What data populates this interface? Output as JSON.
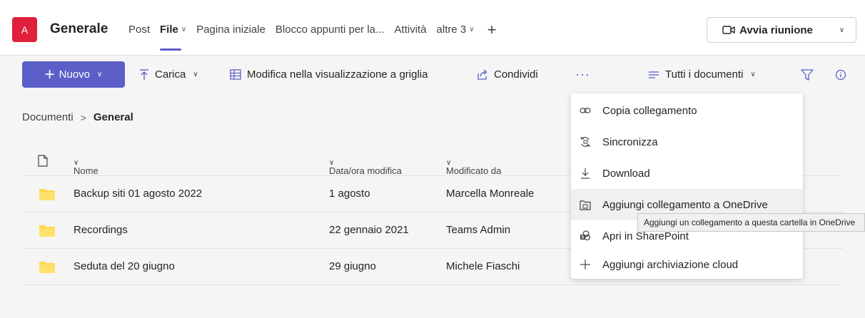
{
  "header": {
    "avatar_letter": "A",
    "avatar_color": "#e0203a",
    "team_name": "Generale",
    "tabs": [
      {
        "label": "Post",
        "active": false
      },
      {
        "label": "File",
        "active": true,
        "has_dropdown": true
      },
      {
        "label": "Pagina iniziale",
        "active": false
      },
      {
        "label": "Blocco appunti per la...",
        "active": false
      },
      {
        "label": "Attività",
        "active": false
      },
      {
        "label": "altre 3",
        "active": false,
        "has_dropdown": true
      }
    ],
    "add_tab_icon": "plus-icon",
    "meeting_button": "Avvia riunione",
    "meeting_icon": "video-camera-icon"
  },
  "toolbar": {
    "new_label": "Nuovo",
    "upload_label": "Carica",
    "grid_label": "Modifica nella visualizzazione a griglia",
    "share_label": "Condividi",
    "more_label": "···",
    "view_label": "Tutti i documenti",
    "accent": "#5b5fc7"
  },
  "breadcrumb": {
    "root": "Documenti",
    "separator": ">",
    "current": "General"
  },
  "table": {
    "columns": [
      "Nome",
      "Data/ora modifica",
      "Modificato da"
    ],
    "rows": [
      {
        "name": "Backup siti 01 agosto 2022",
        "modified": "1 agosto",
        "by": "Marcella Monreale"
      },
      {
        "name": "Recordings",
        "modified": "22 gennaio 2021",
        "by": "Teams Admin"
      },
      {
        "name": "Seduta del 20 giugno",
        "modified": "29 giugno",
        "by": "Michele Fiaschi"
      }
    ],
    "folder_color": "#ffd84a"
  },
  "menu": {
    "items": [
      {
        "label": "Copia collegamento",
        "icon": "link-icon"
      },
      {
        "label": "Sincronizza",
        "icon": "sync-icon"
      },
      {
        "label": "Download",
        "icon": "download-icon"
      },
      {
        "label": "Aggiungi collegamento a OneDrive",
        "icon": "onedrive-shortcut-icon"
      },
      {
        "label": "Apri in SharePoint",
        "icon": "sharepoint-icon"
      },
      {
        "label": "Aggiungi archiviazione cloud",
        "icon": "plus-icon"
      }
    ],
    "tooltip": "Aggiungi un collegamento a questa cartella in OneDrive"
  }
}
